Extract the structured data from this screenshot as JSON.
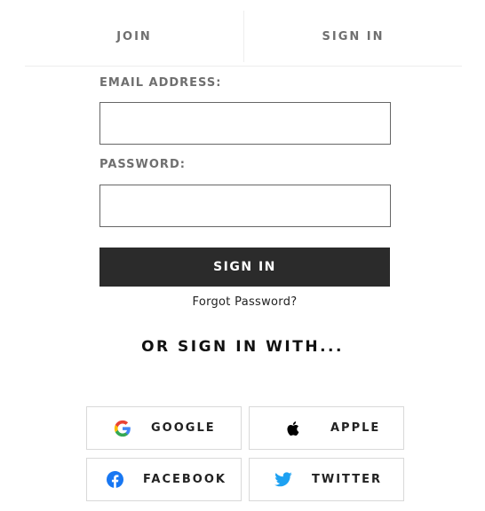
{
  "tabs": {
    "join_label": "JOIN",
    "signin_label": "SIGN IN"
  },
  "form": {
    "email_label": "EMAIL ADDRESS:",
    "email_value": "",
    "password_label": "PASSWORD:",
    "password_value": "",
    "submit_label": "SIGN IN",
    "forgot_label": "Forgot Password?"
  },
  "social": {
    "heading": "OR SIGN IN WITH...",
    "buttons": [
      {
        "label": "GOOGLE",
        "icon": "google-icon"
      },
      {
        "label": "APPLE",
        "icon": "apple-icon"
      },
      {
        "label": "FACEBOOK",
        "icon": "facebook-icon"
      },
      {
        "label": "TWITTER",
        "icon": "twitter-icon"
      }
    ]
  },
  "colors": {
    "primary_button": "#2b2b2b",
    "tab_text": "#6f6f6f",
    "facebook_blue": "#1877f2",
    "twitter_blue": "#1da1f2"
  }
}
